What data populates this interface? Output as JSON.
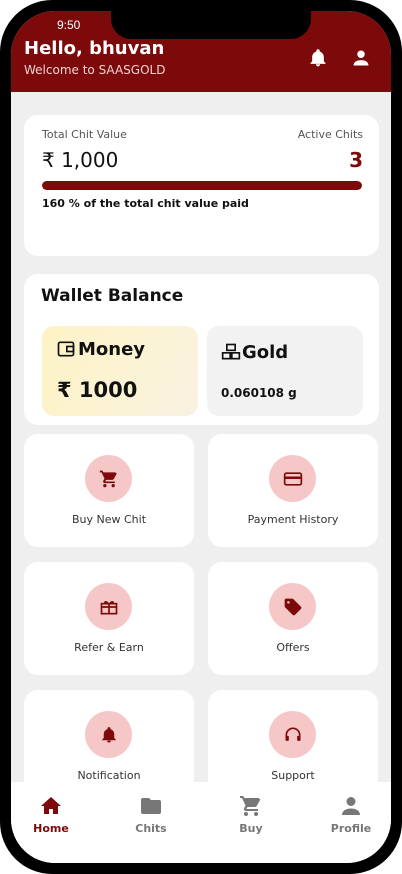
{
  "status_bar": {
    "time": "9:50"
  },
  "header": {
    "greeting": "Hello, bhuvan",
    "subtitle": "Welcome to SAASGOLD",
    "icons": [
      "bell-icon",
      "user-icon"
    ]
  },
  "summary": {
    "total_label": "Total Chit Value",
    "total_value": "₹ 1,000",
    "active_label": "Active Chits",
    "active_value": "3",
    "progress_fraction": 1.0,
    "paid_note": "160 % of the total chit value paid"
  },
  "wallet": {
    "title": "Wallet Balance",
    "money_label": "Money",
    "money_value": "₹ 1000",
    "gold_label": "Gold",
    "gold_value": "0.060108 g"
  },
  "tiles": [
    {
      "label": "Buy New Chit",
      "icon": "cart-icon"
    },
    {
      "label": "Payment History",
      "icon": "card-icon"
    },
    {
      "label": "Refer & Earn",
      "icon": "gift-icon"
    },
    {
      "label": "Offers",
      "icon": "tag-icon"
    },
    {
      "label": "Notification",
      "icon": "bell-icon"
    },
    {
      "label": "Support",
      "icon": "headset-icon"
    }
  ],
  "bottom_nav": [
    {
      "label": "Home",
      "icon": "home-icon",
      "active": true
    },
    {
      "label": "Chits",
      "icon": "folder-icon",
      "active": false
    },
    {
      "label": "Buy",
      "icon": "cart-icon",
      "active": false
    },
    {
      "label": "Profile",
      "icon": "user-icon",
      "active": false
    }
  ],
  "colors": {
    "brand": "#7d0a0a",
    "tile_circle": "#f5c7c7",
    "background": "#efefef"
  }
}
